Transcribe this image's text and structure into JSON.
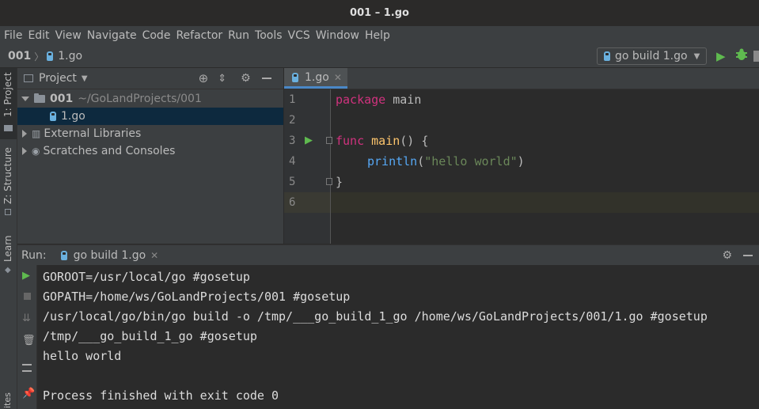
{
  "window": {
    "title": "001 – 1.go"
  },
  "menu": {
    "items": [
      "File",
      "Edit",
      "View",
      "Navigate",
      "Code",
      "Refactor",
      "Run",
      "Tools",
      "VCS",
      "Window",
      "Help"
    ]
  },
  "nav": {
    "project": "001",
    "file": "1.go",
    "separator": "〉"
  },
  "run_config": {
    "label": "go build 1.go"
  },
  "left_tabs": {
    "project": "1: Project",
    "structure": "Z: Structure",
    "learn": "Learn"
  },
  "project_panel": {
    "title": "Project",
    "tree": [
      {
        "label": "001",
        "path": "~/GoLandProjects/001"
      },
      {
        "label": "1.go"
      },
      {
        "label": "External Libraries"
      },
      {
        "label": "Scratches and Consoles"
      }
    ]
  },
  "editor": {
    "tab_label": "1.go",
    "line_numbers": [
      "1",
      "2",
      "3",
      "4",
      "5",
      "6"
    ],
    "lines": {
      "l1_kw": "package",
      "l1_rest": " main",
      "l3_kw": "func",
      "l3_fn": " main",
      "l3_rest": "() {",
      "l4_fn": "println",
      "l4_open": "(",
      "l4_str": "\"hello world\"",
      "l4_close": ")",
      "l5": "}"
    }
  },
  "run_panel": {
    "label": "Run:",
    "tab_label": "go build 1.go",
    "console": [
      "GOROOT=/usr/local/go #gosetup",
      "GOPATH=/home/ws/GoLandProjects/001 #gosetup",
      "/usr/local/go/bin/go build -o /tmp/___go_build_1_go /home/ws/GoLandProjects/001/1.go #gosetup",
      "/tmp/___go_build_1_go #gosetup",
      "hello world",
      "",
      "Process finished with exit code 0"
    ]
  },
  "colors": {
    "accent": "#4a88c7",
    "run_green": "#5fba4f",
    "keyword": "#d0327e",
    "function": "#ffc66d",
    "string": "#6a8759"
  }
}
